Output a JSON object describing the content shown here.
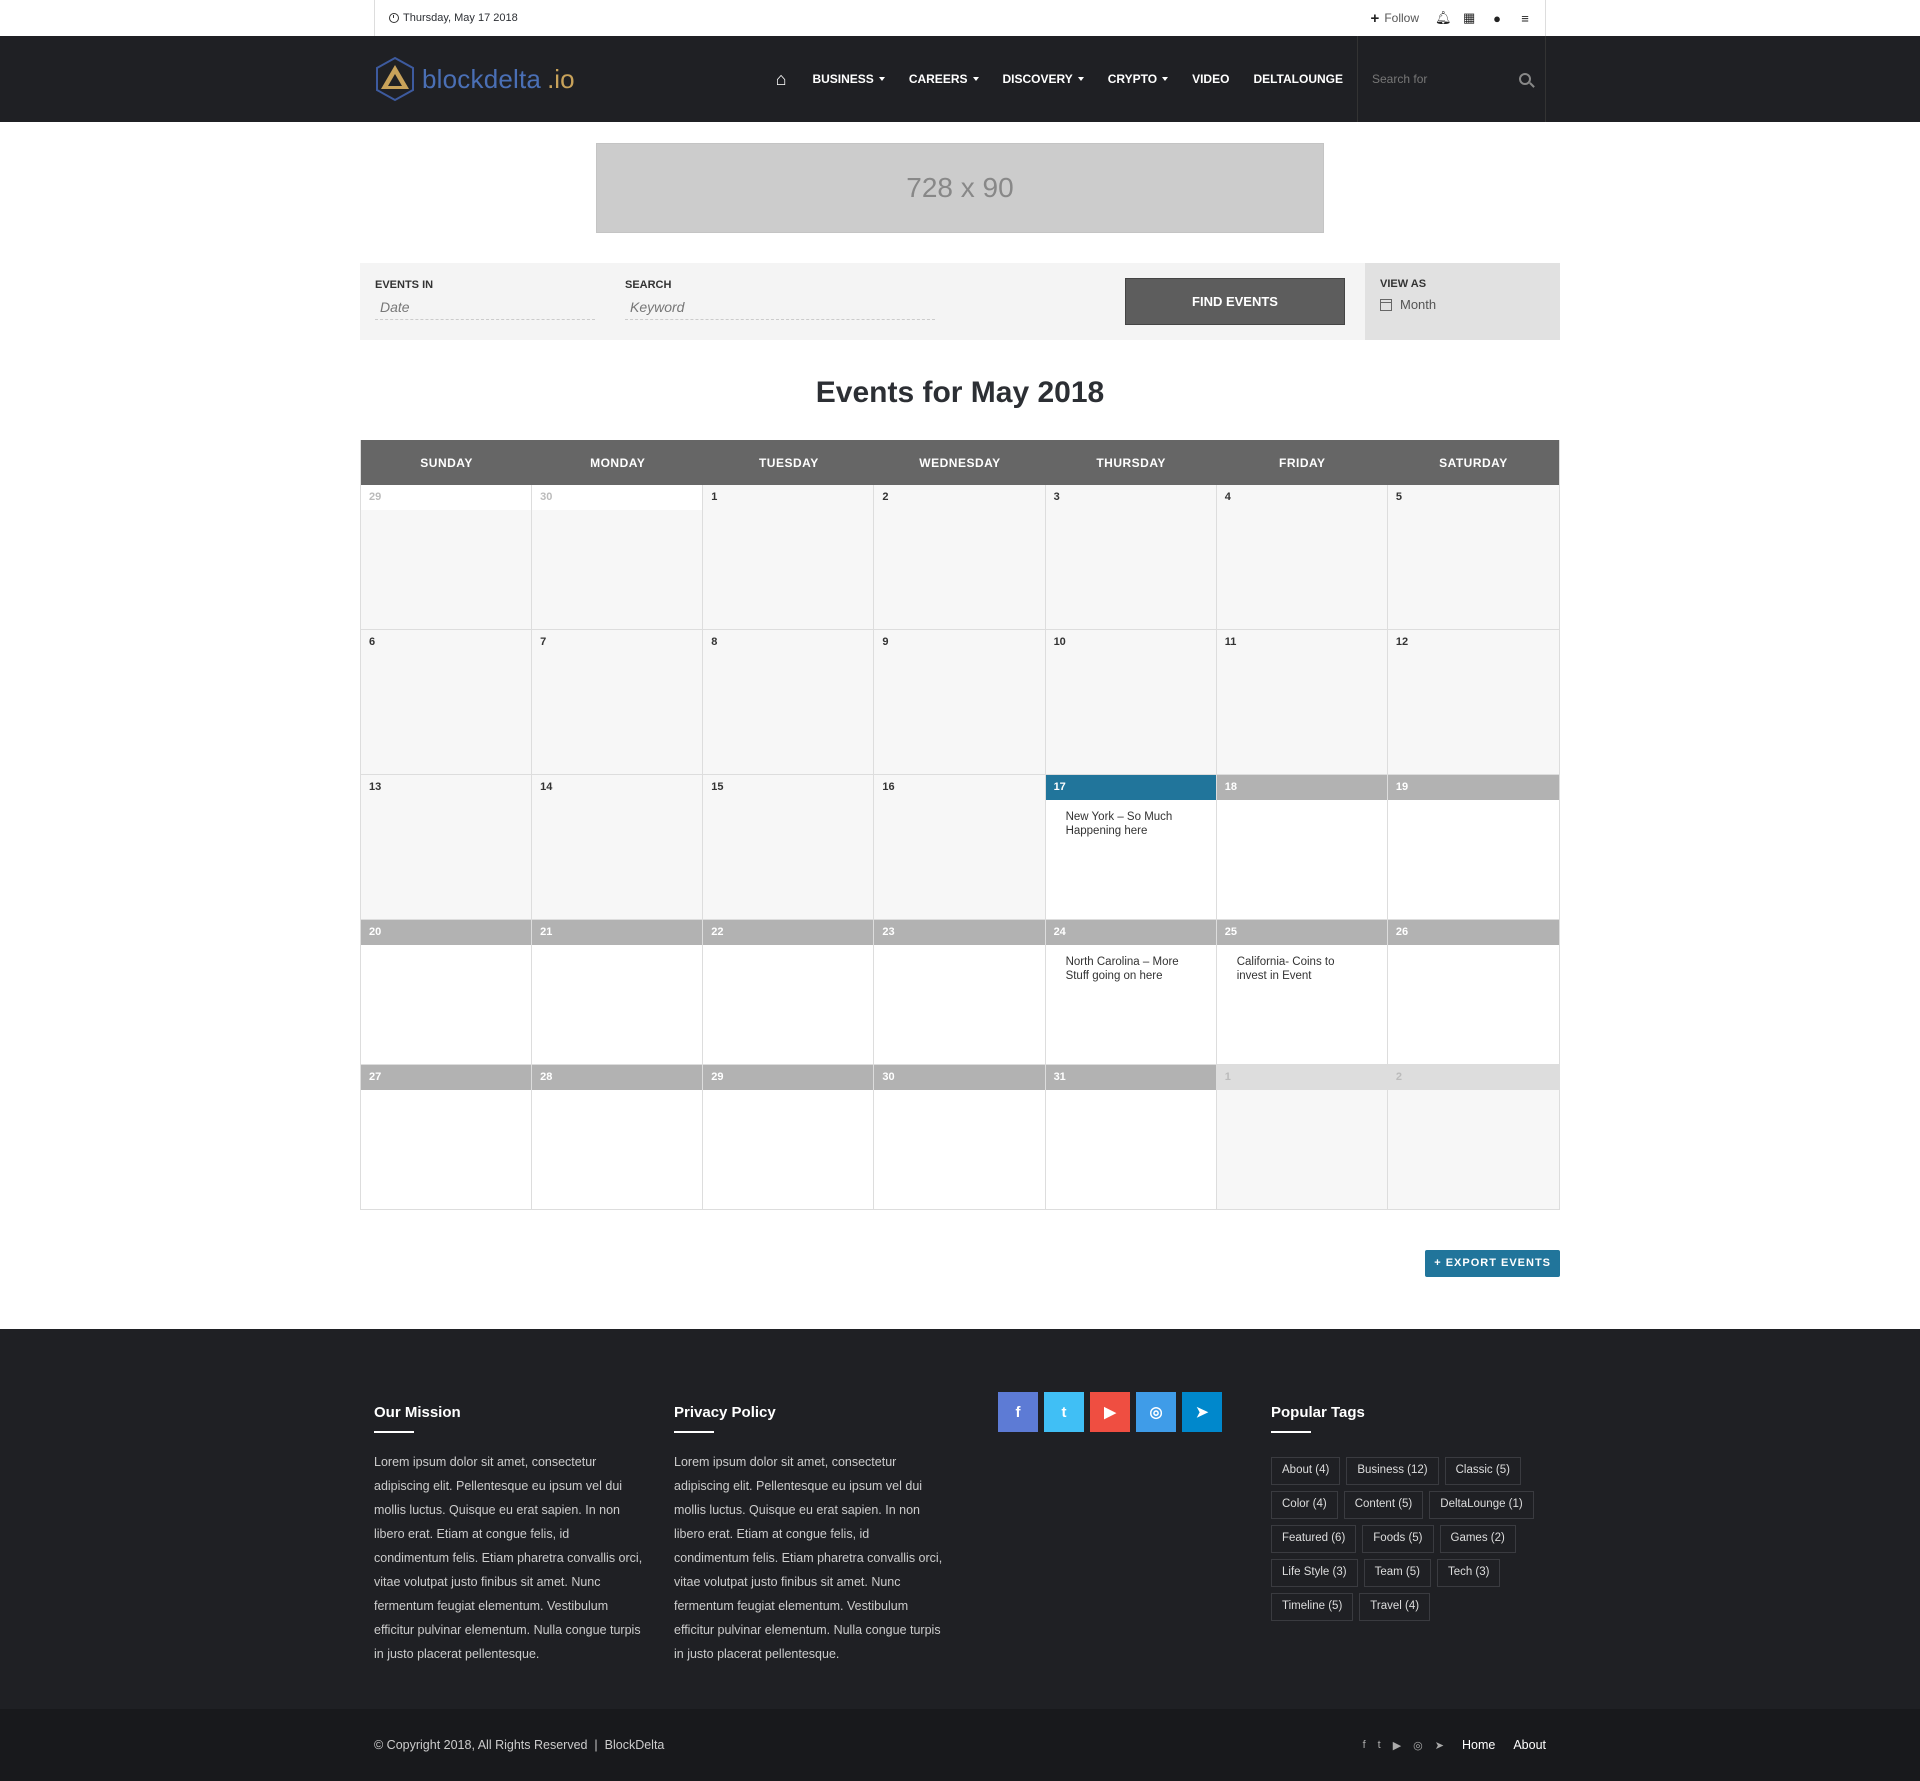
{
  "topbar": {
    "date": "Thursday, May 17 2018",
    "follow": "Follow"
  },
  "header": {
    "logo_main": "blockdelta",
    "logo_tld": ".io",
    "nav": [
      "BUSINESS",
      "CAREERS",
      "DISCOVERY",
      "CRYPTO",
      "VIDEO",
      "DELTALOUNGE"
    ],
    "search_placeholder": "Search for"
  },
  "ad": {
    "text": "728 x 90"
  },
  "filter": {
    "events_in_label": "EVENTS IN",
    "date_placeholder": "Date",
    "search_label": "SEARCH",
    "keyword_placeholder": "Keyword",
    "find_button": "FIND EVENTS",
    "view_as_label": "VIEW AS",
    "view_as_value": "Month"
  },
  "calendar": {
    "title": "Events for May 2018",
    "weekdays": [
      "SUNDAY",
      "MONDAY",
      "TUESDAY",
      "WEDNESDAY",
      "THURSDAY",
      "FRIDAY",
      "SATURDAY"
    ],
    "days": [
      {
        "n": "29",
        "state": "other"
      },
      {
        "n": "30",
        "state": "other"
      },
      {
        "n": "1",
        "state": "past"
      },
      {
        "n": "2",
        "state": "past"
      },
      {
        "n": "3",
        "state": "past"
      },
      {
        "n": "4",
        "state": "past"
      },
      {
        "n": "5",
        "state": "past"
      },
      {
        "n": "6",
        "state": "past"
      },
      {
        "n": "7",
        "state": "past"
      },
      {
        "n": "8",
        "state": "past"
      },
      {
        "n": "9",
        "state": "past"
      },
      {
        "n": "10",
        "state": "past"
      },
      {
        "n": "11",
        "state": "past"
      },
      {
        "n": "12",
        "state": "past"
      },
      {
        "n": "13",
        "state": "past"
      },
      {
        "n": "14",
        "state": "past"
      },
      {
        "n": "15",
        "state": "past"
      },
      {
        "n": "16",
        "state": "past"
      },
      {
        "n": "17",
        "state": "today",
        "event": "New York – So Much Happening here"
      },
      {
        "n": "18",
        "state": "future"
      },
      {
        "n": "19",
        "state": "future"
      },
      {
        "n": "20",
        "state": "future"
      },
      {
        "n": "21",
        "state": "future"
      },
      {
        "n": "22",
        "state": "future"
      },
      {
        "n": "23",
        "state": "future"
      },
      {
        "n": "24",
        "state": "future",
        "event": "North Carolina – More Stuff going on here"
      },
      {
        "n": "25",
        "state": "future",
        "event": "California- Coins to invest in Event"
      },
      {
        "n": "26",
        "state": "future"
      },
      {
        "n": "27",
        "state": "future"
      },
      {
        "n": "28",
        "state": "future"
      },
      {
        "n": "29",
        "state": "future"
      },
      {
        "n": "30",
        "state": "future"
      },
      {
        "n": "31",
        "state": "future"
      },
      {
        "n": "1",
        "state": "next"
      },
      {
        "n": "2",
        "state": "next"
      }
    ],
    "export_label": "+ EXPORT EVENTS"
  },
  "footer": {
    "mission_title": "Our Mission",
    "mission_text": "Lorem ipsum dolor sit amet, consectetur adipiscing elit. Pellentesque eu ipsum vel dui mollis luctus. Quisque eu erat sapien. In non libero erat. Etiam at congue felis, id condimentum felis. Etiam pharetra convallis orci, vitae volutpat justo finibus sit amet. Nunc fermentum feugiat elementum. Vestibulum efficitur pulvinar elementum. Nulla congue turpis in justo placerat pellentesque.",
    "privacy_title": "Privacy Policy",
    "privacy_text": "Lorem ipsum dolor sit amet, consectetur adipiscing elit. Pellentesque eu ipsum vel dui mollis luctus. Quisque eu erat sapien. In non libero erat. Etiam at congue felis, id condimentum felis. Etiam pharetra convallis orci, vitae volutpat justo finibus sit amet. Nunc fermentum feugiat elementum. Vestibulum efficitur pulvinar elementum. Nulla congue turpis in justo placerat pellentesque.",
    "social": [
      {
        "icon": "facebook-icon",
        "glyph": "f",
        "color": "#5d7bd5"
      },
      {
        "icon": "twitter-icon",
        "glyph": "t",
        "color": "#40bff5"
      },
      {
        "icon": "youtube-icon",
        "glyph": "▶",
        "color": "#ef4e41"
      },
      {
        "icon": "instagram-icon",
        "glyph": "◎",
        "color": "#3f9ce8"
      },
      {
        "icon": "telegram-icon",
        "glyph": "➤",
        "color": "#0088cc"
      }
    ],
    "tags_title": "Popular Tags",
    "tags": [
      "About (4)",
      "Business (12)",
      "Classic (5)",
      "Color (4)",
      "Content (5)",
      "DeltaLounge (1)",
      "Featured (6)",
      "Foods (5)",
      "Games (2)",
      "Life Style (3)",
      "Team (5)",
      "Tech (3)",
      "Timeline (5)",
      "Travel (4)"
    ],
    "copyright": "© Copyright 2018, All Rights Reserved  |  BlockDelta",
    "bottom_links": [
      "Home",
      "About"
    ]
  }
}
